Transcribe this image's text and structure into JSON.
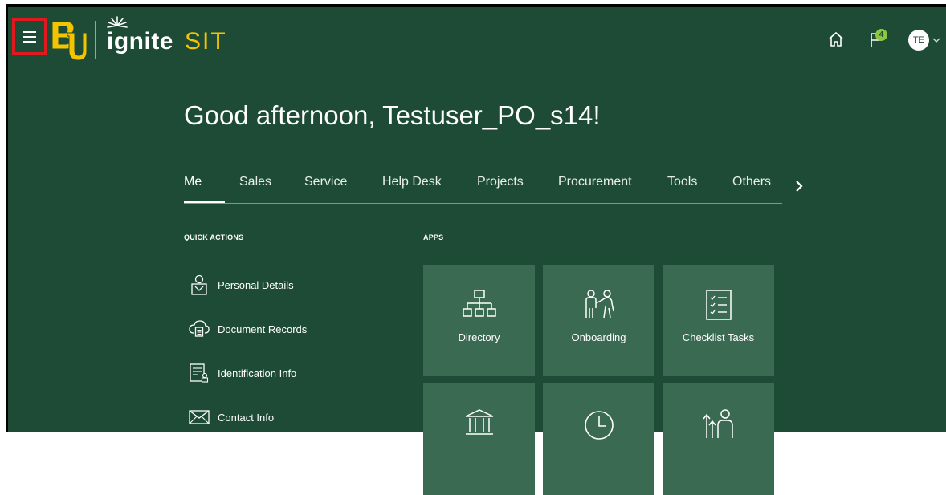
{
  "header": {
    "menu_icon": "hamburger-menu-icon",
    "logo": "BU",
    "brand_name": "ignite",
    "environment": "SIT",
    "home_icon": "home-icon",
    "notifications_icon": "notifications-flag-icon",
    "notifications_count": "4",
    "avatar_initials": "TE",
    "avatar_chevron_icon": "chevron-down-icon"
  },
  "greeting": "Good afternoon, Testuser_PO_s14!",
  "tabs": [
    "Me",
    "Sales",
    "Service",
    "Help Desk",
    "Projects",
    "Procurement",
    "Tools",
    "Others"
  ],
  "active_tab": "Me",
  "tabs_next_icon": "chevron-right-icon",
  "quick_actions": {
    "title": "QUICK ACTIONS",
    "items": [
      {
        "label": "Personal Details",
        "icon": "person-icon"
      },
      {
        "label": "Document Records",
        "icon": "cloud-document-icon"
      },
      {
        "label": "Identification Info",
        "icon": "id-card-icon"
      },
      {
        "label": "Contact Info",
        "icon": "envelope-icon"
      }
    ]
  },
  "apps": {
    "title": "APPS",
    "tiles": [
      {
        "label": "Directory",
        "icon": "org-chart-icon"
      },
      {
        "label": "Onboarding",
        "icon": "onboarding-people-icon"
      },
      {
        "label": "Checklist Tasks",
        "icon": "checklist-icon"
      },
      {
        "label": "",
        "icon": "bank-building-icon"
      },
      {
        "label": "",
        "icon": "clock-icon"
      },
      {
        "label": "",
        "icon": "career-growth-icon"
      }
    ]
  },
  "colors": {
    "background": "#1d4b35",
    "tile": "#3b6a53",
    "brand_gold": "#f5c400",
    "highlight_red": "#e0191e",
    "badge_green": "#8ec63f"
  }
}
